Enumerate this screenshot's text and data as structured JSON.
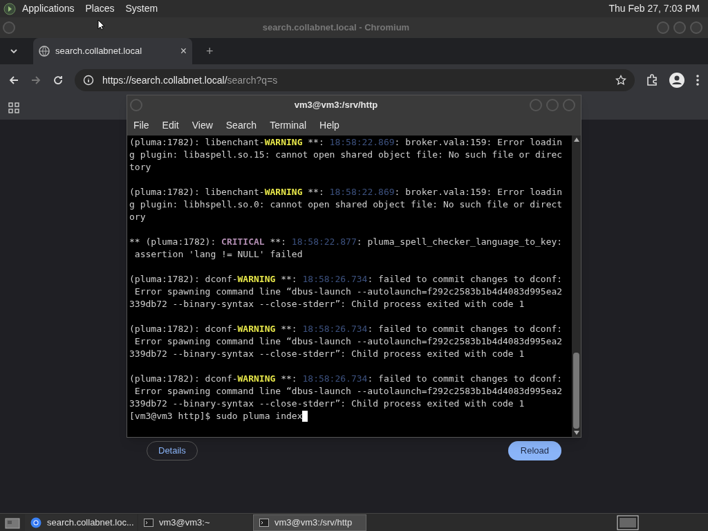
{
  "top_panel": {
    "menus": [
      "Applications",
      "Places",
      "System"
    ],
    "clock": "Thu Feb 27, 7:03 PM"
  },
  "browser": {
    "title": "search.collabnet.local - Chromium",
    "tab": {
      "title": "search.collabnet.local",
      "close": "×",
      "new_tab": "+"
    },
    "url": {
      "host": "https://search.collabnet.local/",
      "path": "search?q=s"
    },
    "page_buttons": [
      {
        "label": "Details",
        "kind": "outline"
      },
      {
        "label": "Reload",
        "kind": "filled"
      }
    ]
  },
  "terminal": {
    "title": "vm3@vm3:/srv/http",
    "menu": [
      "File",
      "Edit",
      "View",
      "Search",
      "Terminal",
      "Help"
    ],
    "messages": [
      {
        "rows": [
          [
            {
              "kind": "plain",
              "text": "(pluma:1782): libenchant-"
            },
            {
              "kind": "warning",
              "text": "WARNING"
            },
            {
              "kind": "plain",
              "text": " **: "
            },
            {
              "kind": "time",
              "text": "18:58:22.869"
            },
            {
              "kind": "plain",
              "text": ": broker.vala:159: Error loadin"
            }
          ],
          [
            {
              "kind": "plain",
              "text": "g plugin: libaspell.so.15: cannot open shared object file: No such file or direc"
            }
          ],
          [
            {
              "kind": "plain",
              "text": "tory"
            }
          ]
        ]
      },
      {
        "rows": [
          [
            {
              "kind": "plain",
              "text": "(pluma:1782): libenchant-"
            },
            {
              "kind": "warning",
              "text": "WARNING"
            },
            {
              "kind": "plain",
              "text": " **: "
            },
            {
              "kind": "time",
              "text": "18:58:22.869"
            },
            {
              "kind": "plain",
              "text": ": broker.vala:159: Error loadin"
            }
          ],
          [
            {
              "kind": "plain",
              "text": "g plugin: libhspell.so.0: cannot open shared object file: No such file or direct"
            }
          ],
          [
            {
              "kind": "plain",
              "text": "ory"
            }
          ]
        ]
      },
      {
        "rows": [
          [
            {
              "kind": "plain",
              "text": "** (pluma:1782): "
            },
            {
              "kind": "critical",
              "text": "CRITICAL"
            },
            {
              "kind": "plain",
              "text": " **: "
            },
            {
              "kind": "time",
              "text": "18:58:22.877"
            },
            {
              "kind": "plain",
              "text": ": pluma_spell_checker_language_to_key:"
            }
          ],
          [
            {
              "kind": "plain",
              "text": " assertion 'lang != NULL' failed"
            }
          ]
        ]
      },
      {
        "rows": [
          [
            {
              "kind": "plain",
              "text": "(pluma:1782): dconf-"
            },
            {
              "kind": "warning",
              "text": "WARNING"
            },
            {
              "kind": "plain",
              "text": " **: "
            },
            {
              "kind": "time",
              "text": "18:58:26.734"
            },
            {
              "kind": "plain",
              "text": ": failed to commit changes to dconf:"
            }
          ],
          [
            {
              "kind": "plain",
              "text": " Error spawning command line “dbus-launch --autolaunch=f292c2583b1b4d4083d995ea2"
            }
          ],
          [
            {
              "kind": "plain",
              "text": "339db72 --binary-syntax --close-stderr”: Child process exited with code 1"
            }
          ]
        ]
      },
      {
        "rows": [
          [
            {
              "kind": "plain",
              "text": "(pluma:1782): dconf-"
            },
            {
              "kind": "warning",
              "text": "WARNING"
            },
            {
              "kind": "plain",
              "text": " **: "
            },
            {
              "kind": "time",
              "text": "18:58:26.734"
            },
            {
              "kind": "plain",
              "text": ": failed to commit changes to dconf:"
            }
          ],
          [
            {
              "kind": "plain",
              "text": " Error spawning command line “dbus-launch --autolaunch=f292c2583b1b4d4083d995ea2"
            }
          ],
          [
            {
              "kind": "plain",
              "text": "339db72 --binary-syntax --close-stderr”: Child process exited with code 1"
            }
          ]
        ]
      },
      {
        "rows": [
          [
            {
              "kind": "plain",
              "text": "(pluma:1782): dconf-"
            },
            {
              "kind": "warning",
              "text": "WARNING"
            },
            {
              "kind": "plain",
              "text": " **: "
            },
            {
              "kind": "time",
              "text": "18:58:26.734"
            },
            {
              "kind": "plain",
              "text": ": failed to commit changes to dconf:"
            }
          ],
          [
            {
              "kind": "plain",
              "text": " Error spawning command line “dbus-launch --autolaunch=f292c2583b1b4d4083d995ea2"
            }
          ],
          [
            {
              "kind": "plain",
              "text": "339db72 --binary-syntax --close-stderr”: Child process exited with code 1"
            }
          ]
        ]
      }
    ],
    "prompt": {
      "text": "[vm3@vm3 http]$ sudo pluma index",
      "cursor": true
    }
  },
  "taskbar": [
    {
      "label": "search.collabnet.loc...",
      "kind": "browser",
      "selected": false
    },
    {
      "label": "vm3@vm3:~",
      "kind": "terminal",
      "selected": false
    },
    {
      "label": "vm3@vm3:/srv/http",
      "kind": "terminal",
      "selected": true
    }
  ]
}
